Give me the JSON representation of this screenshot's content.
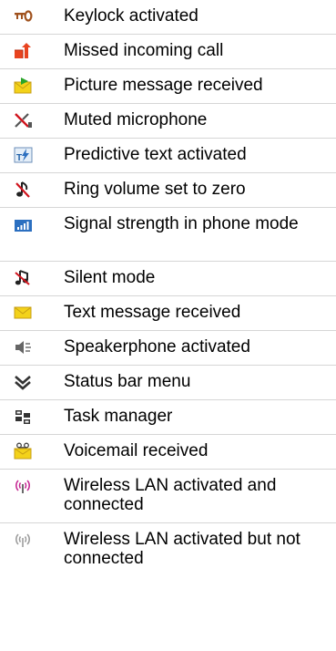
{
  "rows": [
    {
      "icon": "keylock-icon",
      "label": "Keylock activated"
    },
    {
      "icon": "missed-call-icon",
      "label": "Missed incoming call"
    },
    {
      "icon": "picture-message-icon",
      "label": "Picture message received"
    },
    {
      "icon": "muted-microphone-icon",
      "label": "Muted microphone"
    },
    {
      "icon": "predictive-text-icon",
      "label": "Predictive text activated"
    },
    {
      "icon": "ring-volume-zero-icon",
      "label": "Ring volume set to zero"
    },
    {
      "icon": "signal-strength-icon",
      "label": "Signal strength in phone mode"
    },
    {
      "icon": "silent-mode-icon",
      "label": "Silent mode"
    },
    {
      "icon": "text-message-icon",
      "label": "Text message received"
    },
    {
      "icon": "speakerphone-icon",
      "label": "Speakerphone activated"
    },
    {
      "icon": "status-bar-menu-icon",
      "label": "Status bar menu"
    },
    {
      "icon": "task-manager-icon",
      "label": "Task manager"
    },
    {
      "icon": "voicemail-icon",
      "label": "Voicemail received"
    },
    {
      "icon": "wlan-connected-icon",
      "label": "Wireless LAN activated and connected"
    },
    {
      "icon": "wlan-not-connected-icon",
      "label": "Wireless LAN activated but not connected"
    }
  ],
  "colors": {
    "separator": "#d6d6d6",
    "keylock": "#a0521e",
    "missed_call": "#e8431f",
    "envelope": "#f3d21a",
    "envelope_outline": "#c79e13",
    "arrow_green": "#2aa52a",
    "blue_signal": "#2b6fc0",
    "red_x": "#d0141d",
    "wlan_on": "#c62a94",
    "wlan_off": "#9c9c9c"
  }
}
